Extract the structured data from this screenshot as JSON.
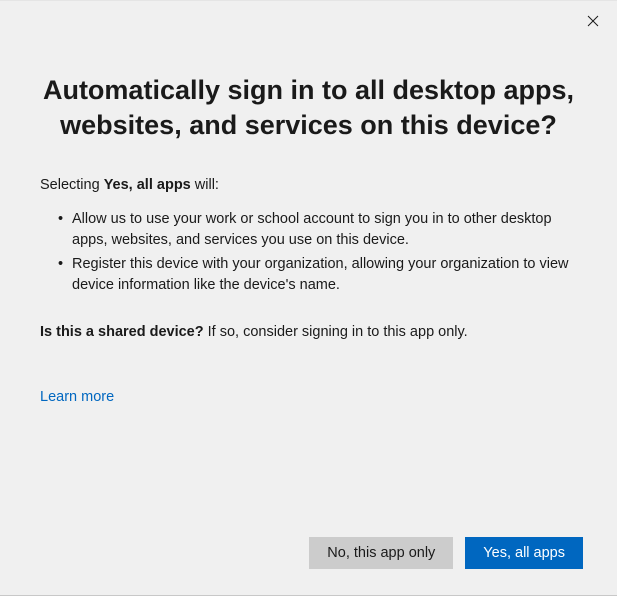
{
  "dialog": {
    "title": "Automatically sign in to all desktop apps, websites, and services on this device?",
    "intro_prefix": "Selecting ",
    "intro_bold": "Yes, all apps",
    "intro_suffix": " will:",
    "bullets": [
      "Allow us to use your work or school account to sign you in to other desktop apps, websites, and services you use on this device.",
      "Register this device with your organization, allowing your organization to view device information like the device's name."
    ],
    "shared_bold": "Is this a shared device?",
    "shared_suffix": " If so, consider signing in to this app only.",
    "learn_more": "Learn more",
    "buttons": {
      "secondary": "No, this app only",
      "primary": "Yes, all apps"
    }
  }
}
